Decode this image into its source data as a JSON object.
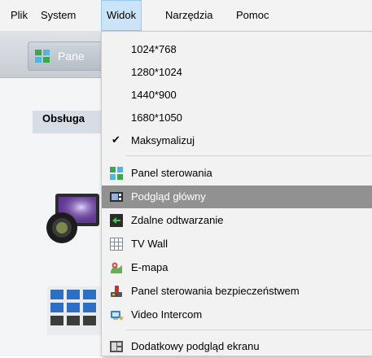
{
  "menubar": {
    "items": [
      {
        "label": "Plik"
      },
      {
        "label": "System"
      },
      {
        "label": "Widok"
      },
      {
        "label": "Narzędzia"
      },
      {
        "label": "Pomoc"
      }
    ],
    "active": "Widok"
  },
  "app": {
    "panel_tab_label": "Pane",
    "section_label": "Obsługa"
  },
  "dropdown": {
    "resolutions": [
      "1024*768",
      "1280*1024",
      "1440*900",
      "1680*1050"
    ],
    "maximize": {
      "label": "Maksymalizuj",
      "checked": true
    },
    "items": [
      {
        "label": "Panel sterowania",
        "icon": "panel-grid-icon"
      },
      {
        "label": "Podgląd główny",
        "icon": "main-preview-icon",
        "highlighted": true
      },
      {
        "label": "Zdalne odtwarzanie",
        "icon": "remote-playback-icon"
      },
      {
        "label": "TV Wall",
        "icon": "tv-wall-icon"
      },
      {
        "label": "E-mapa",
        "icon": "emap-icon"
      },
      {
        "label": "Panel sterowania bezpieczeństwem",
        "icon": "security-panel-icon"
      },
      {
        "label": "Video Intercom",
        "icon": "video-intercom-icon"
      }
    ],
    "extra": {
      "label": "Dodatkowy podgląd ekranu",
      "icon": "extra-preview-icon"
    }
  },
  "colors": {
    "menu_active_bg": "#cce4f7",
    "highlight_bg": "#919191"
  }
}
